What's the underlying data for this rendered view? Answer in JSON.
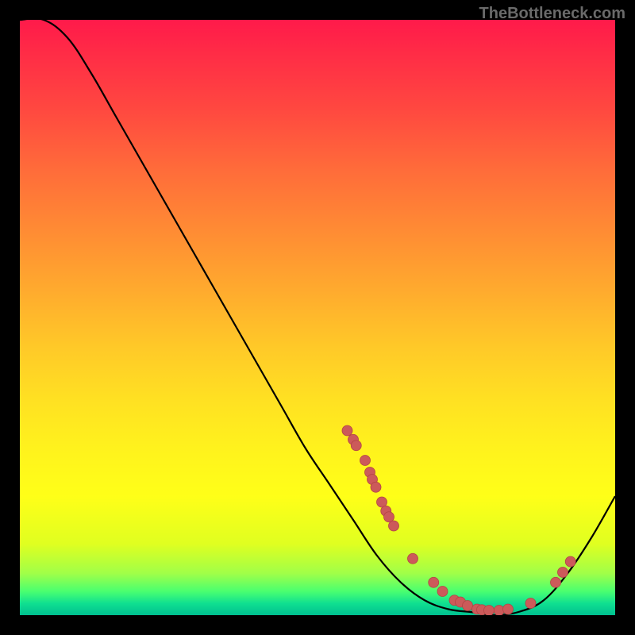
{
  "watermark": "TheBottleneck.com",
  "chart_data": {
    "type": "line",
    "title": "",
    "xlabel": "",
    "ylabel": "",
    "xlim": [
      0,
      1
    ],
    "ylim": [
      0,
      1
    ],
    "curve": {
      "x": [
        0.0,
        0.04,
        0.08,
        0.12,
        0.16,
        0.2,
        0.24,
        0.28,
        0.32,
        0.36,
        0.4,
        0.44,
        0.48,
        0.52,
        0.56,
        0.6,
        0.64,
        0.68,
        0.72,
        0.76,
        0.8,
        0.84,
        0.88,
        0.92,
        0.96,
        1.0
      ],
      "y": [
        1.0,
        1.0,
        0.97,
        0.91,
        0.84,
        0.77,
        0.7,
        0.63,
        0.56,
        0.49,
        0.42,
        0.35,
        0.28,
        0.22,
        0.16,
        0.1,
        0.055,
        0.025,
        0.01,
        0.005,
        0.0,
        0.006,
        0.025,
        0.07,
        0.13,
        0.2
      ]
    },
    "points": [
      {
        "x": 0.55,
        "y": 0.31
      },
      {
        "x": 0.56,
        "y": 0.295
      },
      {
        "x": 0.565,
        "y": 0.285
      },
      {
        "x": 0.58,
        "y": 0.26
      },
      {
        "x": 0.588,
        "y": 0.24
      },
      {
        "x": 0.592,
        "y": 0.228
      },
      {
        "x": 0.598,
        "y": 0.215
      },
      {
        "x": 0.608,
        "y": 0.19
      },
      {
        "x": 0.615,
        "y": 0.175
      },
      {
        "x": 0.62,
        "y": 0.165
      },
      {
        "x": 0.628,
        "y": 0.15
      },
      {
        "x": 0.66,
        "y": 0.095
      },
      {
        "x": 0.695,
        "y": 0.055
      },
      {
        "x": 0.71,
        "y": 0.04
      },
      {
        "x": 0.73,
        "y": 0.025
      },
      {
        "x": 0.74,
        "y": 0.022
      },
      {
        "x": 0.752,
        "y": 0.016
      },
      {
        "x": 0.768,
        "y": 0.01
      },
      {
        "x": 0.776,
        "y": 0.009
      },
      {
        "x": 0.788,
        "y": 0.008
      },
      {
        "x": 0.805,
        "y": 0.008
      },
      {
        "x": 0.82,
        "y": 0.01
      },
      {
        "x": 0.858,
        "y": 0.02
      },
      {
        "x": 0.9,
        "y": 0.055
      },
      {
        "x": 0.912,
        "y": 0.072
      },
      {
        "x": 0.925,
        "y": 0.09
      }
    ],
    "colors": {
      "curve": "#000000",
      "point_fill": "#cc5a5a",
      "point_stroke": "#b34444"
    }
  }
}
